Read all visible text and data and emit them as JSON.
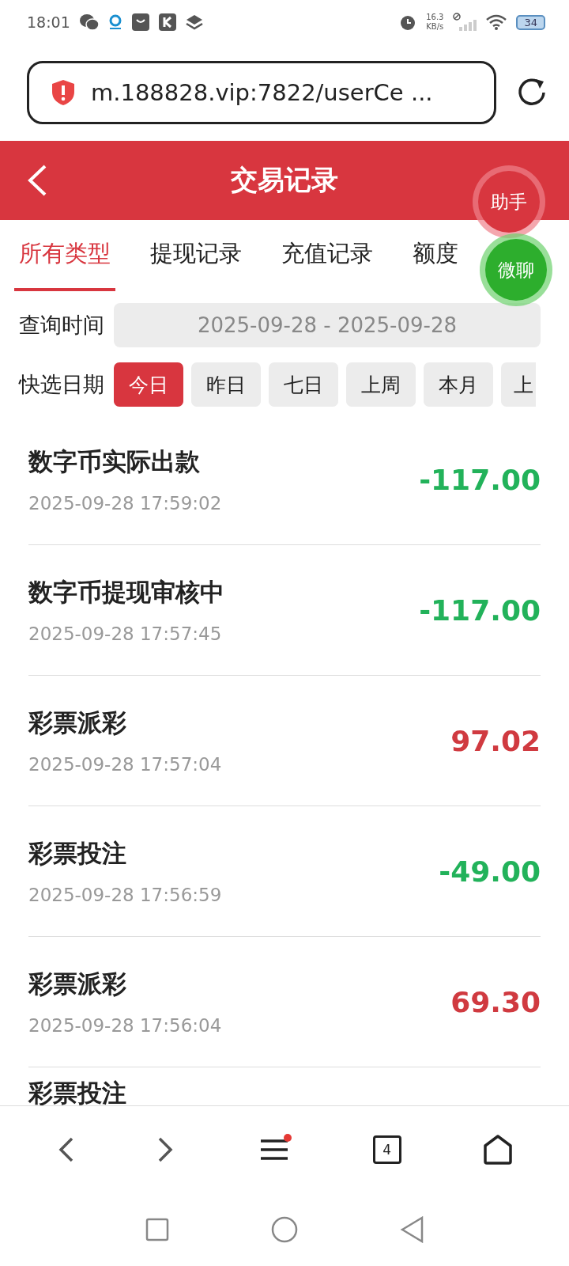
{
  "status_bar": {
    "time": "18:01",
    "net_speed": "16.3",
    "net_unit": "KB/s",
    "battery": "34"
  },
  "browser": {
    "url": "m.188828.vip:7822/userCe ...",
    "tab_count": "4",
    "menu_badge": true
  },
  "header": {
    "title": "交易记录"
  },
  "tabs": [
    {
      "label": "所有类型",
      "selected": true
    },
    {
      "label": "提现记录",
      "selected": false
    },
    {
      "label": "充值记录",
      "selected": false
    },
    {
      "label": "额度",
      "selected": false
    }
  ],
  "query": {
    "label": "查询时间",
    "value": "2025-09-28 - 2025-09-28"
  },
  "quick": {
    "label": "快选日期",
    "options": [
      {
        "label": "今日",
        "selected": true
      },
      {
        "label": "昨日",
        "selected": false
      },
      {
        "label": "七日",
        "selected": false
      },
      {
        "label": "上周",
        "selected": false
      },
      {
        "label": "本月",
        "selected": false
      },
      {
        "label": "上",
        "selected": false
      }
    ]
  },
  "records": [
    {
      "title": "数字币实际出款",
      "time": "2025-09-28 17:59:02",
      "amount": "-117.00",
      "color": "#22b25a"
    },
    {
      "title": "数字币提现审核中",
      "time": "2025-09-28 17:57:45",
      "amount": "-117.00",
      "color": "#22b25a"
    },
    {
      "title": "彩票派彩",
      "time": "2025-09-28 17:57:04",
      "amount": "97.02",
      "color": "#d03a40"
    },
    {
      "title": "彩票投注",
      "time": "2025-09-28 17:56:59",
      "amount": "-49.00",
      "color": "#22b25a"
    },
    {
      "title": "彩票派彩",
      "time": "2025-09-28 17:56:04",
      "amount": "69.30",
      "color": "#d03a40"
    },
    {
      "title": "彩票投注"
    }
  ],
  "floating": [
    {
      "label": "助手",
      "kind": "red"
    },
    {
      "label": "微聊",
      "kind": "green"
    }
  ]
}
